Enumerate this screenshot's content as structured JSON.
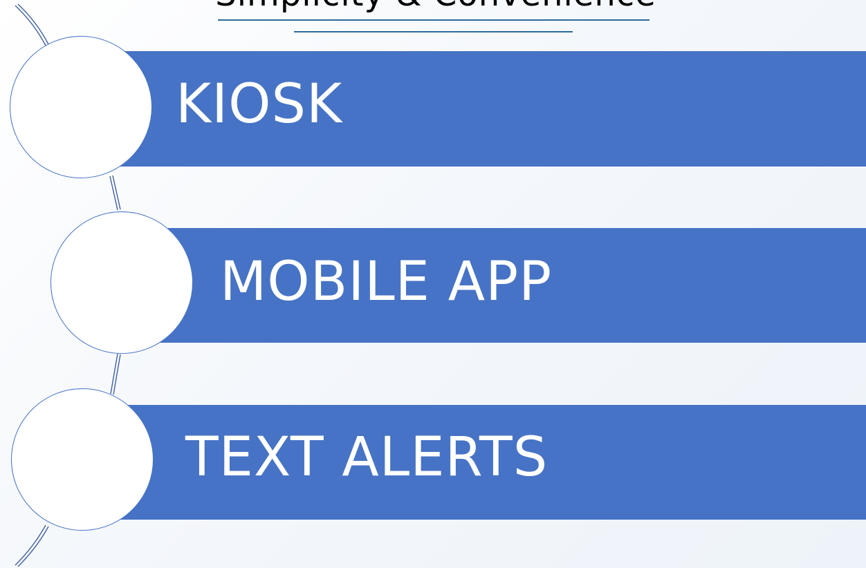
{
  "title": "Simplicity & Convenience",
  "items": [
    {
      "label": "KIOSK"
    },
    {
      "label": "MOBILE APP"
    },
    {
      "label": "TEXT ALERTS"
    }
  ],
  "colors": {
    "band": "#4673c5",
    "rule": "#2b6a9a",
    "connector": "#3f5f9e",
    "label": "#ffffff"
  }
}
